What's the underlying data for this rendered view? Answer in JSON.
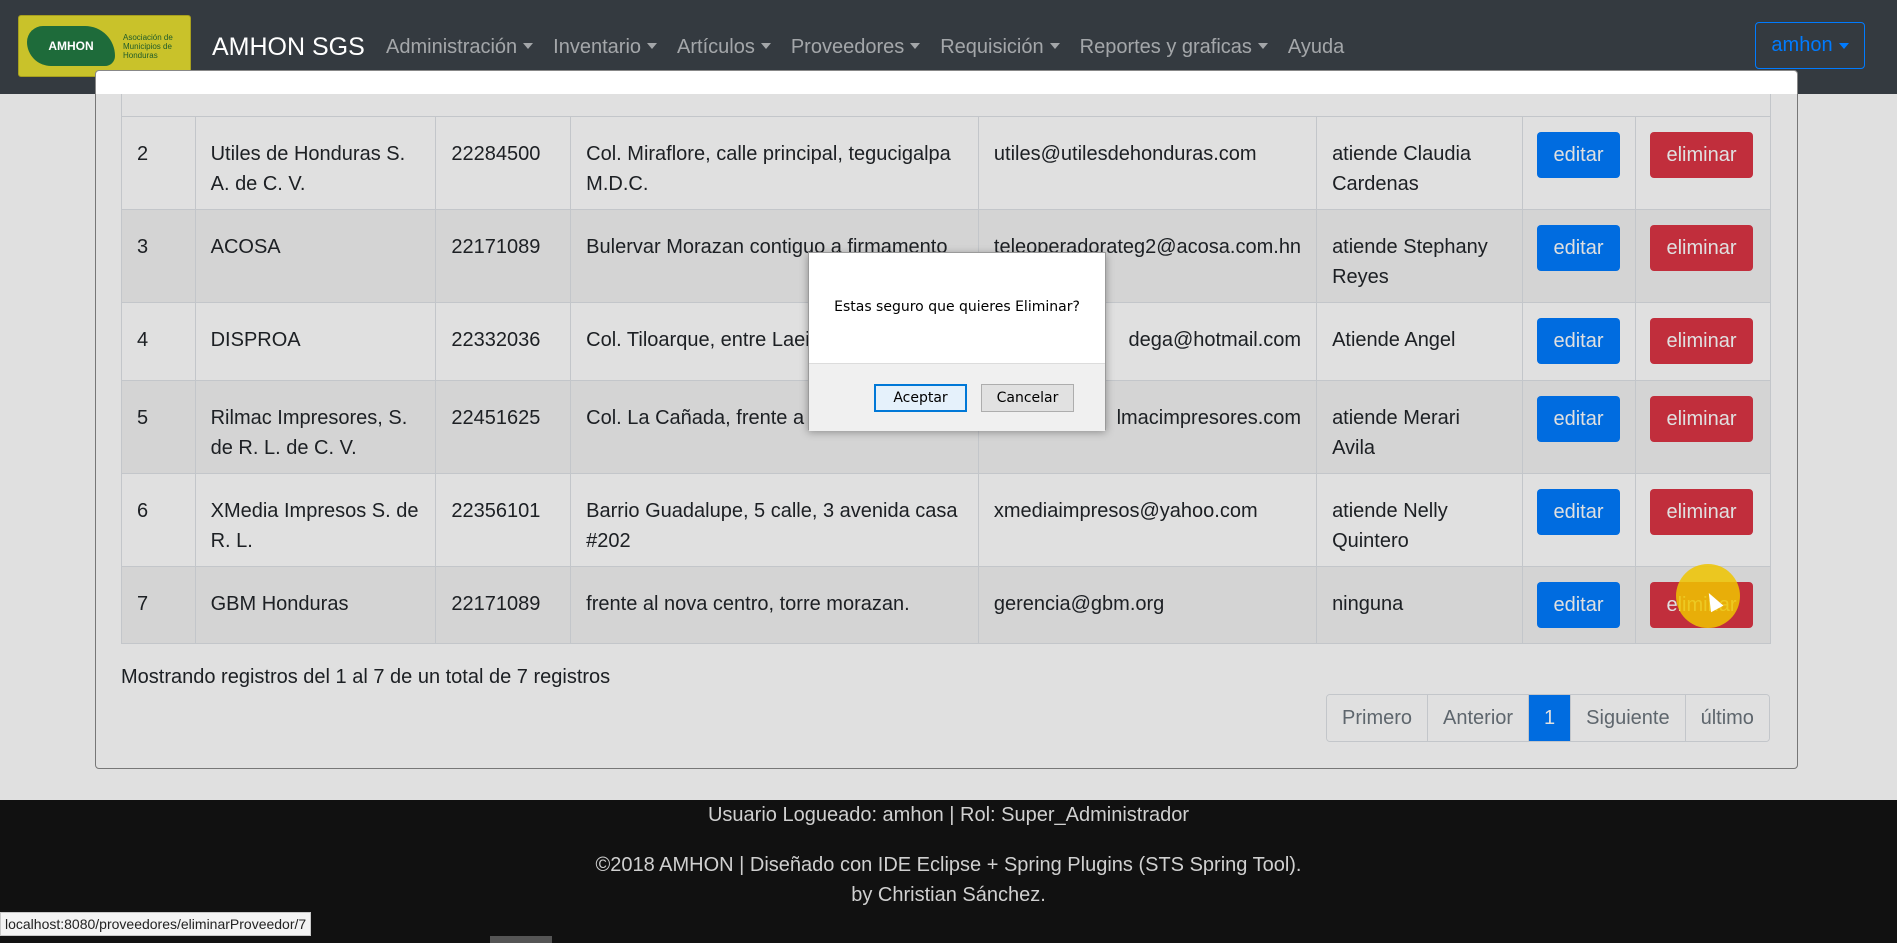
{
  "navbar": {
    "logo_badge": "AMHON",
    "logo_caption": "Asociación de Municipios de Honduras",
    "brand": "AMHON SGS",
    "menu": [
      "Administración",
      "Inventario",
      "Artículos",
      "Proveedores",
      "Requisición",
      "Reportes y graficas",
      "Ayuda"
    ],
    "user": "amhon"
  },
  "table": {
    "rows": [
      {
        "id": "2",
        "name": "Utiles de Honduras S. A. de C. V.",
        "phone": "22284500",
        "address": "Col. Miraflore, calle principal, tegucigalpa M.D.C.",
        "email": "utiles@utilesdehonduras.com",
        "contact": "atiende Claudia Cardenas"
      },
      {
        "id": "3",
        "name": "ACOSA",
        "phone": "22171089",
        "address": "Bulervar Morazan contiguo a firmamento",
        "email": "teleoperadorateg2@acosa.com.hn",
        "contact": "atiende Stephany Reyes"
      },
      {
        "id": "4",
        "name": "DISPROA",
        "phone": "22332036",
        "address": "Col. Tiloarque, entre Laeiz",
        "email": "dega@hotmail.com",
        "contact": "Atiende Angel"
      },
      {
        "id": "5",
        "name": "Rilmac Impresores, S. de R. L. de C. V.",
        "phone": "22451625",
        "address": "Col. La Cañada, frente a g Nuevo Mundo",
        "email": "lmacimpresores.com",
        "contact": "atiende Merari Avila"
      },
      {
        "id": "6",
        "name": "XMedia Impresos S. de R. L.",
        "phone": "22356101",
        "address": "Barrio Guadalupe, 5 calle, 3 avenida casa #202",
        "email": "xmediaimpresos@yahoo.com",
        "contact": "atiende Nelly Quintero"
      },
      {
        "id": "7",
        "name": "GBM Honduras",
        "phone": "22171089",
        "address": "frente al nova centro, torre morazan.",
        "email": "gerencia@gbm.org",
        "contact": "ninguna"
      }
    ],
    "edit_label": "editar",
    "delete_label": "eliminar"
  },
  "summary": "Mostrando registros del 1 al 7 de un total de 7 registros",
  "pagination": [
    "Primero",
    "Anterior",
    "1",
    "Siguiente",
    "último"
  ],
  "footer": {
    "line1": "Usuario Logueado: amhon | Rol: Super_Administrador",
    "line2": "©2018 AMHON | Diseñado con IDE Eclipse + Spring Plugins (STS Spring Tool).",
    "line3": "by Christian Sánchez."
  },
  "status_url": "localhost:8080/proveedores/eliminarProveedor/7",
  "dialog": {
    "message": "Estas seguro que quieres Eliminar?",
    "ok": "Aceptar",
    "cancel": "Cancelar"
  }
}
